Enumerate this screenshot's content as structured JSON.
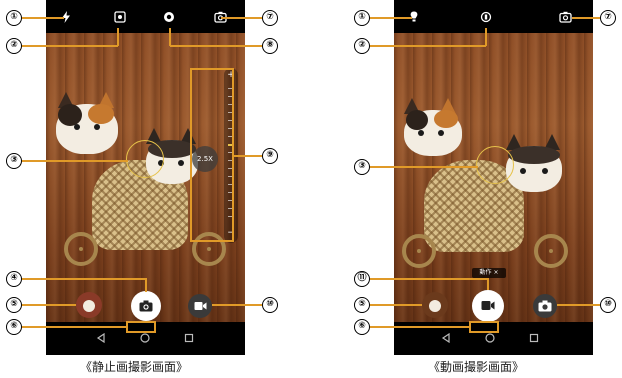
{
  "left_screen": {
    "caption": "《静止画撮影画面》",
    "zoom_level": "2.5X",
    "zoom_plus": "+",
    "zoom_minus": "−",
    "active_page_dot": 1,
    "page_dot_count": 2,
    "icons": {
      "flash": "flash-icon",
      "settings": "settings-icon",
      "mode": "record-dot-icon",
      "switch_camera": "switch-camera-icon",
      "shutter": "camera-icon",
      "video": "video-camera-icon"
    }
  },
  "right_screen": {
    "caption": "《動画撮影画面》",
    "rec_tag": "動作 ×",
    "active_page_dot": 1,
    "page_dot_count": 2,
    "icons": {
      "light": "light-icon",
      "pause": "record-dot-icon",
      "switch_camera": "switch-camera-icon",
      "record": "video-camera-icon",
      "still": "camera-icon"
    }
  },
  "callouts": {
    "c1": "①",
    "c2": "②",
    "c3": "③",
    "c4": "④",
    "c5": "⑤",
    "c6": "⑥",
    "c7": "⑦",
    "c8": "⑧",
    "c9": "⑨",
    "c10": "⑩",
    "c11": "⑪"
  },
  "colors": {
    "highlight": "#e09a28",
    "focus": "#e6c24a",
    "bar": "#000000"
  }
}
